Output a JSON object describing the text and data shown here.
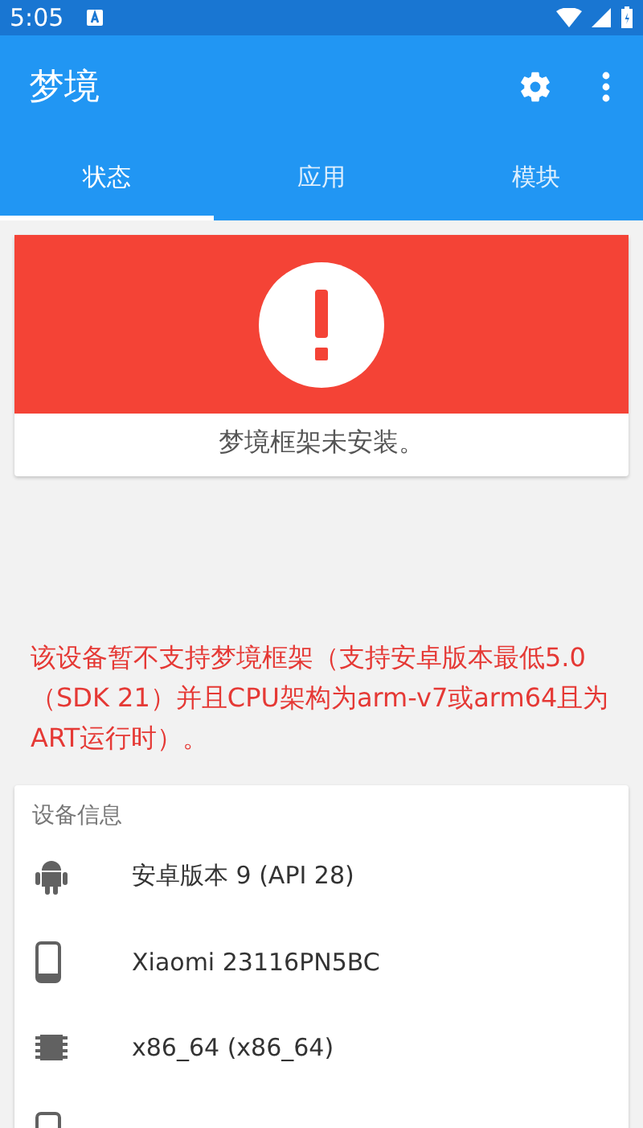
{
  "status_bar": {
    "time": "5:05"
  },
  "app_bar": {
    "title": "梦境"
  },
  "tabs": [
    {
      "label": "状态",
      "selected": true
    },
    {
      "label": "应用",
      "selected": false
    },
    {
      "label": "模块",
      "selected": false
    }
  ],
  "status_card": {
    "message": "梦境框架未安装。"
  },
  "warning": "该设备暂不支持梦境框架（支持安卓版本最低5.0（SDK 21）并且CPU架构为arm-v7或arm64且为ART运行时）。",
  "device_info": {
    "heading": "设备信息",
    "rows": [
      {
        "kind": "android",
        "text": "安卓版本 9 (API 28)"
      },
      {
        "kind": "phone",
        "text": "Xiaomi 23116PN5BC"
      },
      {
        "kind": "chip",
        "text": "x86_64 (x86_64)"
      },
      {
        "kind": "phone"
      }
    ]
  }
}
